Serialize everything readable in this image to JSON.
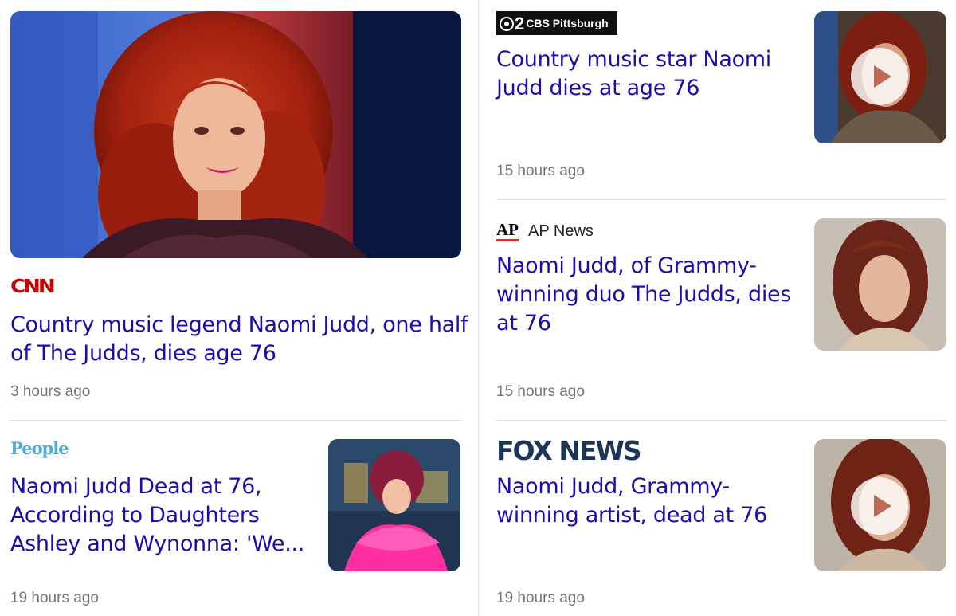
{
  "articles": [
    {
      "source": "CNN",
      "headline_lines": [
        "Country music legend Naomi Judd, one half",
        "of The Judds, dies age 76"
      ],
      "time": "3 hours ago",
      "image": "hero-photo-woman-red-hair"
    },
    {
      "source": "CBS Pittsburgh",
      "source_mark": "2",
      "headline_lines": [
        "Country music star Naomi",
        "Judd dies at age 76"
      ],
      "time": "15 hours ago",
      "video": true
    },
    {
      "source": "AP News",
      "source_mark": "AP",
      "headline_lines": [
        "Naomi Judd, of Grammy-",
        "winning duo The Judds, dies",
        "at 76"
      ],
      "time": "15 hours ago",
      "video": false
    },
    {
      "source": "People",
      "headline_lines": [
        "Naomi Judd Dead at 76,",
        "According to Daughters",
        "Ashley and Wynonna: 'We..."
      ],
      "time": "19 hours ago",
      "video": false
    },
    {
      "source": "FOX NEWS",
      "headline_lines": [
        "Naomi Judd, Grammy-",
        "winning artist, dead at 76"
      ],
      "time": "19 hours ago",
      "video": true
    }
  ],
  "icons": {
    "play": "play-icon"
  },
  "colors": {
    "headline": "#1a0dab",
    "time": "#70757a",
    "cnn": "#cc0000",
    "people": "#4fa9d9",
    "fox": "#1d3557"
  }
}
